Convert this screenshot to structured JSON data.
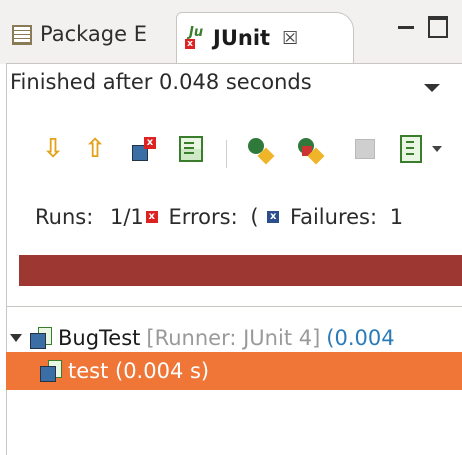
{
  "tabs": {
    "package_label": "Package E",
    "junit_label": "JUnit",
    "close_glyph": "☒"
  },
  "status": {
    "message": "Finished after 0.048 seconds"
  },
  "counters": {
    "runs_label": "Runs:",
    "runs_value": "1/1",
    "errors_label": "Errors:",
    "errors_value": "(",
    "failures_label": "Failures:",
    "failures_value": "1"
  },
  "progress": {
    "color": "#9c3732",
    "state": "failed",
    "fraction": 1.0
  },
  "tree": {
    "suite": {
      "name": "BugTest",
      "runner": "[Runner: JUnit 4]",
      "time": "(0.004"
    },
    "test": {
      "label": "test (0.004 s)",
      "selected": true,
      "highlight_color": "#f07637"
    }
  },
  "icons": {
    "next_failure": "arrow-down-icon",
    "previous_failure": "arrow-up-icon",
    "show_failures_only": "failures-only-icon",
    "scroll_lock": "scroll-lock-icon",
    "rerun": "rerun-icon",
    "rerun_failed_first": "rerun-failed-first-icon",
    "stop": "stop-icon",
    "history": "history-icon"
  }
}
